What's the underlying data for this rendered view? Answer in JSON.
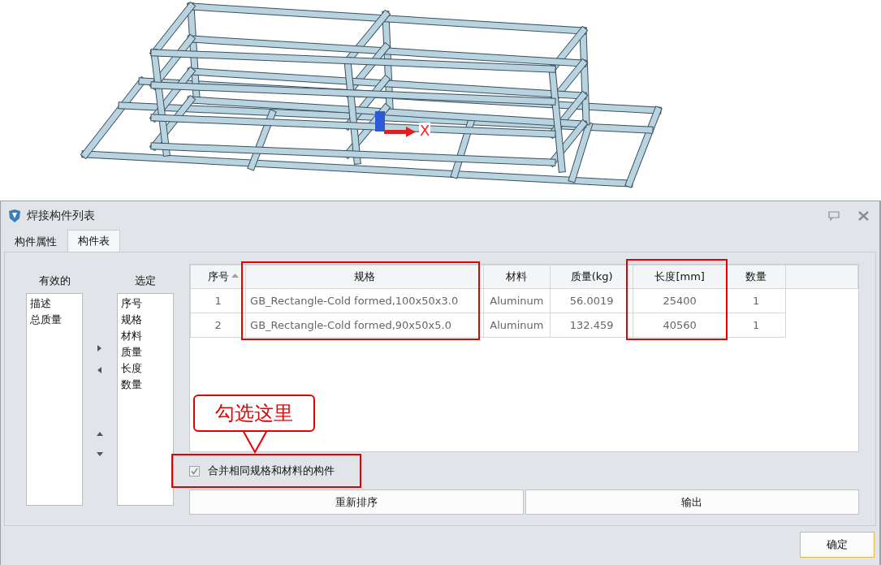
{
  "viewport": {
    "axis_label": "X"
  },
  "window": {
    "title": "焊接构件列表"
  },
  "tabs": [
    {
      "label": "构件属性",
      "selected": false
    },
    {
      "label": "构件表",
      "selected": true
    }
  ],
  "available_list": {
    "label": "有效的",
    "items": [
      "描述",
      "总质量"
    ]
  },
  "selected_list": {
    "label": "选定",
    "items": [
      "序号",
      "规格",
      "材料",
      "质量",
      "长度",
      "数量"
    ]
  },
  "table": {
    "columns": [
      {
        "label": "序号",
        "sorted": true
      },
      {
        "label": "规格",
        "sorted": false
      },
      {
        "label": "材料",
        "sorted": false
      },
      {
        "label": "质量(kg)",
        "sorted": false
      },
      {
        "label": "长度[mm]",
        "sorted": false
      },
      {
        "label": "数量",
        "sorted": false
      }
    ],
    "rows": [
      [
        "1",
        "GB_Rectangle-Cold formed,100x50x3.0",
        "Aluminum",
        "56.0019",
        "25400",
        "1"
      ],
      [
        "2",
        "GB_Rectangle-Cold formed,90x50x5.0",
        "Aluminum",
        "132.459",
        "40560",
        "1"
      ]
    ]
  },
  "merge_checkbox": {
    "label": "合并相同规格和材料的构件",
    "checked": true
  },
  "buttons": [
    "重新排序",
    "输出"
  ],
  "ok_button": "确定",
  "callout": "勾选这里"
}
